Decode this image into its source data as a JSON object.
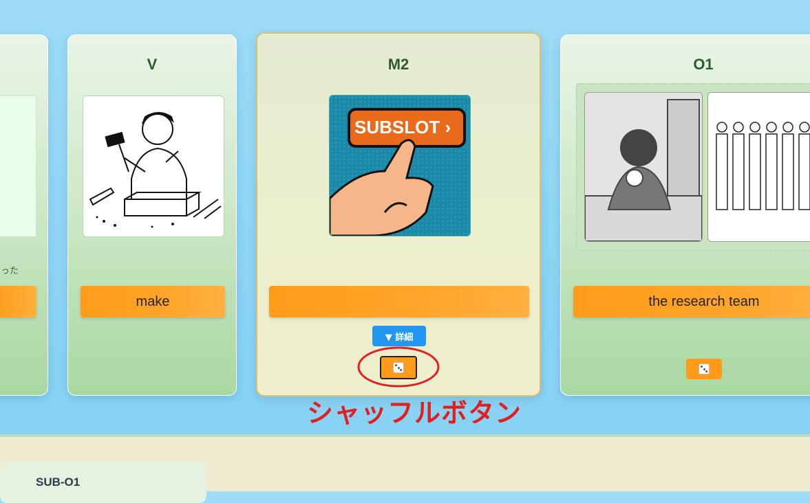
{
  "slots": {
    "left_partial": {
      "caption": "った",
      "phrase": ""
    },
    "v": {
      "title": "V",
      "phrase": "make"
    },
    "m2": {
      "title": "M2",
      "phrase": "",
      "image_label": "SUBSLOT ›",
      "detail_label": "▼ 詳細"
    },
    "o1": {
      "title": "O1",
      "phrase": "the research team"
    }
  },
  "annotation": {
    "label": "シャッフルボタン",
    "color": "#e02020"
  },
  "bottom": {
    "panel_title": "SUB-O1"
  },
  "colors": {
    "orange": "#ff9c1a",
    "detail_blue": "#2196f3",
    "title_green": "#2f5a2f"
  },
  "icons": [
    "dice-icon",
    "hammer-icon",
    "magnifier-icon",
    "chevron-right-icon"
  ]
}
